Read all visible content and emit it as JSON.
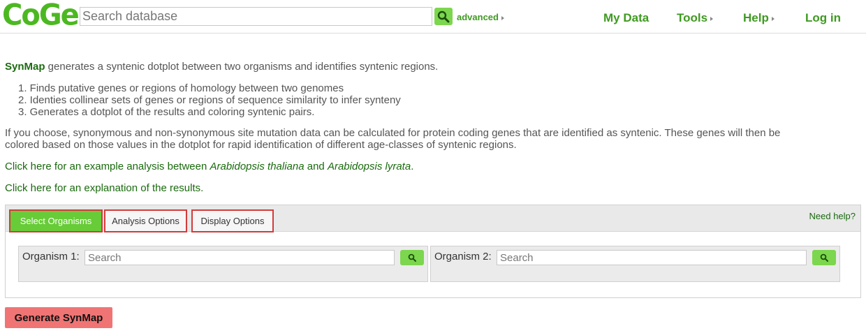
{
  "header": {
    "logo": "CoGe",
    "search_placeholder": "Search database",
    "advanced_label": "advanced",
    "nav": {
      "my_data": "My Data",
      "tools": "Tools",
      "help": "Help",
      "login": "Log in"
    }
  },
  "intro": {
    "brand": "SynMap",
    "text": " generates a syntenic dotplot between two organisms and identifies syntenic regions."
  },
  "steps": [
    "1. Finds putative genes or regions of homology between two genomes",
    "2. Identies collinear sets of genes or regions of sequence similarity to infer synteny",
    "3. Generates a dotplot of the results and coloring syntenic pairs."
  ],
  "paragraph": "If you choose, synonymous and non-synonymous site mutation data can be calculated for protein coding genes that are identified as syntenic. These genes will then be colored based on those values in the dotplot for rapid identification of different age-classes of syntenic regions.",
  "example_link": {
    "prefix": "Click here for an example analysis between ",
    "organism_a": "Arabidopsis thaliana",
    "and": " and ",
    "organism_b": "Arabidopsis lyrata",
    "suffix": "."
  },
  "explanation_link": "Click here for an explanation of the results.",
  "panel": {
    "tabs": [
      "Select Organisms",
      "Analysis Options",
      "Display Options"
    ],
    "active_tab": "Select Organisms",
    "help_link": "Need help?",
    "organism1": {
      "label": "Organism 1:",
      "placeholder": "Search"
    },
    "organism2": {
      "label": "Organism 2:",
      "placeholder": "Search"
    }
  },
  "generate_button": "Generate SynMap",
  "colors": {
    "brand_green": "#4cb821",
    "link_green": "#1a6a0e",
    "active_tab": "#67cc37",
    "tab_border": "#d23b3b",
    "generate": "#f07474"
  },
  "icons": [
    "magnifier-icon",
    "triangle-right-icon"
  ]
}
